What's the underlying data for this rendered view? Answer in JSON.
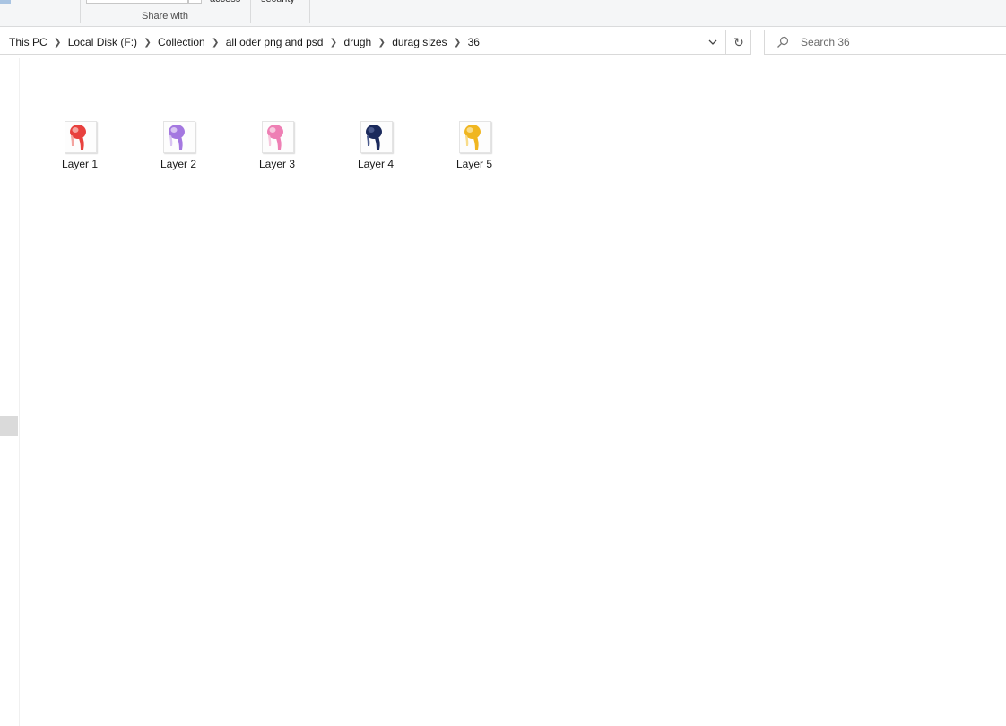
{
  "ribbon": {
    "group_label": "Share with",
    "cut_label_1": "access",
    "cut_label_2": "security"
  },
  "address": {
    "crumbs": [
      "This PC",
      "Local Disk (F:)",
      "Collection",
      "all oder png and psd",
      "drugh",
      "durag sizes",
      "36"
    ]
  },
  "search": {
    "placeholder": "Search 36"
  },
  "files": [
    {
      "label": "Layer 1",
      "color": "#e8413e",
      "accent": "#f4a4a0"
    },
    {
      "label": "Layer 2",
      "color": "#a478e0",
      "accent": "#d9c5f2"
    },
    {
      "label": "Layer 3",
      "color": "#ee7fb4",
      "accent": "#f7c9de"
    },
    {
      "label": "Layer 4",
      "color": "#1b2a5c",
      "accent": "#4a5a8c"
    },
    {
      "label": "Layer 5",
      "color": "#f0b620",
      "accent": "#f8dc8a"
    }
  ]
}
